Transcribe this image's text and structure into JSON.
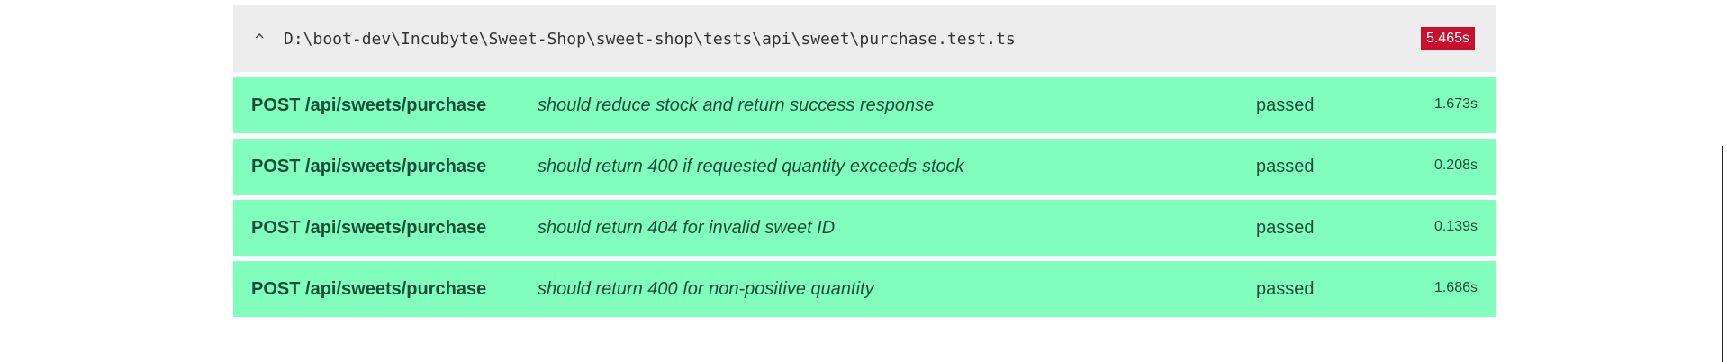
{
  "suite": {
    "caret": "^",
    "path": "D:\\boot-dev\\Incubyte\\Sweet-Shop\\sweet-shop\\tests\\api\\sweet\\purchase.test.ts",
    "duration": "5.465s",
    "duration_color": "#c8102e"
  },
  "colors": {
    "pass_background": "#82ffbf",
    "pass_text": "#164f34",
    "header_background": "#ededed"
  },
  "tests": [
    {
      "suite": "POST /api/sweets/purchase",
      "title": "should reduce stock and return success response",
      "status": "passed",
      "duration": "1.673s"
    },
    {
      "suite": "POST /api/sweets/purchase",
      "title": "should return 400 if requested quantity exceeds stock",
      "status": "passed",
      "duration": "0.208s"
    },
    {
      "suite": "POST /api/sweets/purchase",
      "title": "should return 404 for invalid sweet ID",
      "status": "passed",
      "duration": "0.139s"
    },
    {
      "suite": "POST /api/sweets/purchase",
      "title": "should return 400 for non-positive quantity",
      "status": "passed",
      "duration": "1.686s"
    }
  ]
}
